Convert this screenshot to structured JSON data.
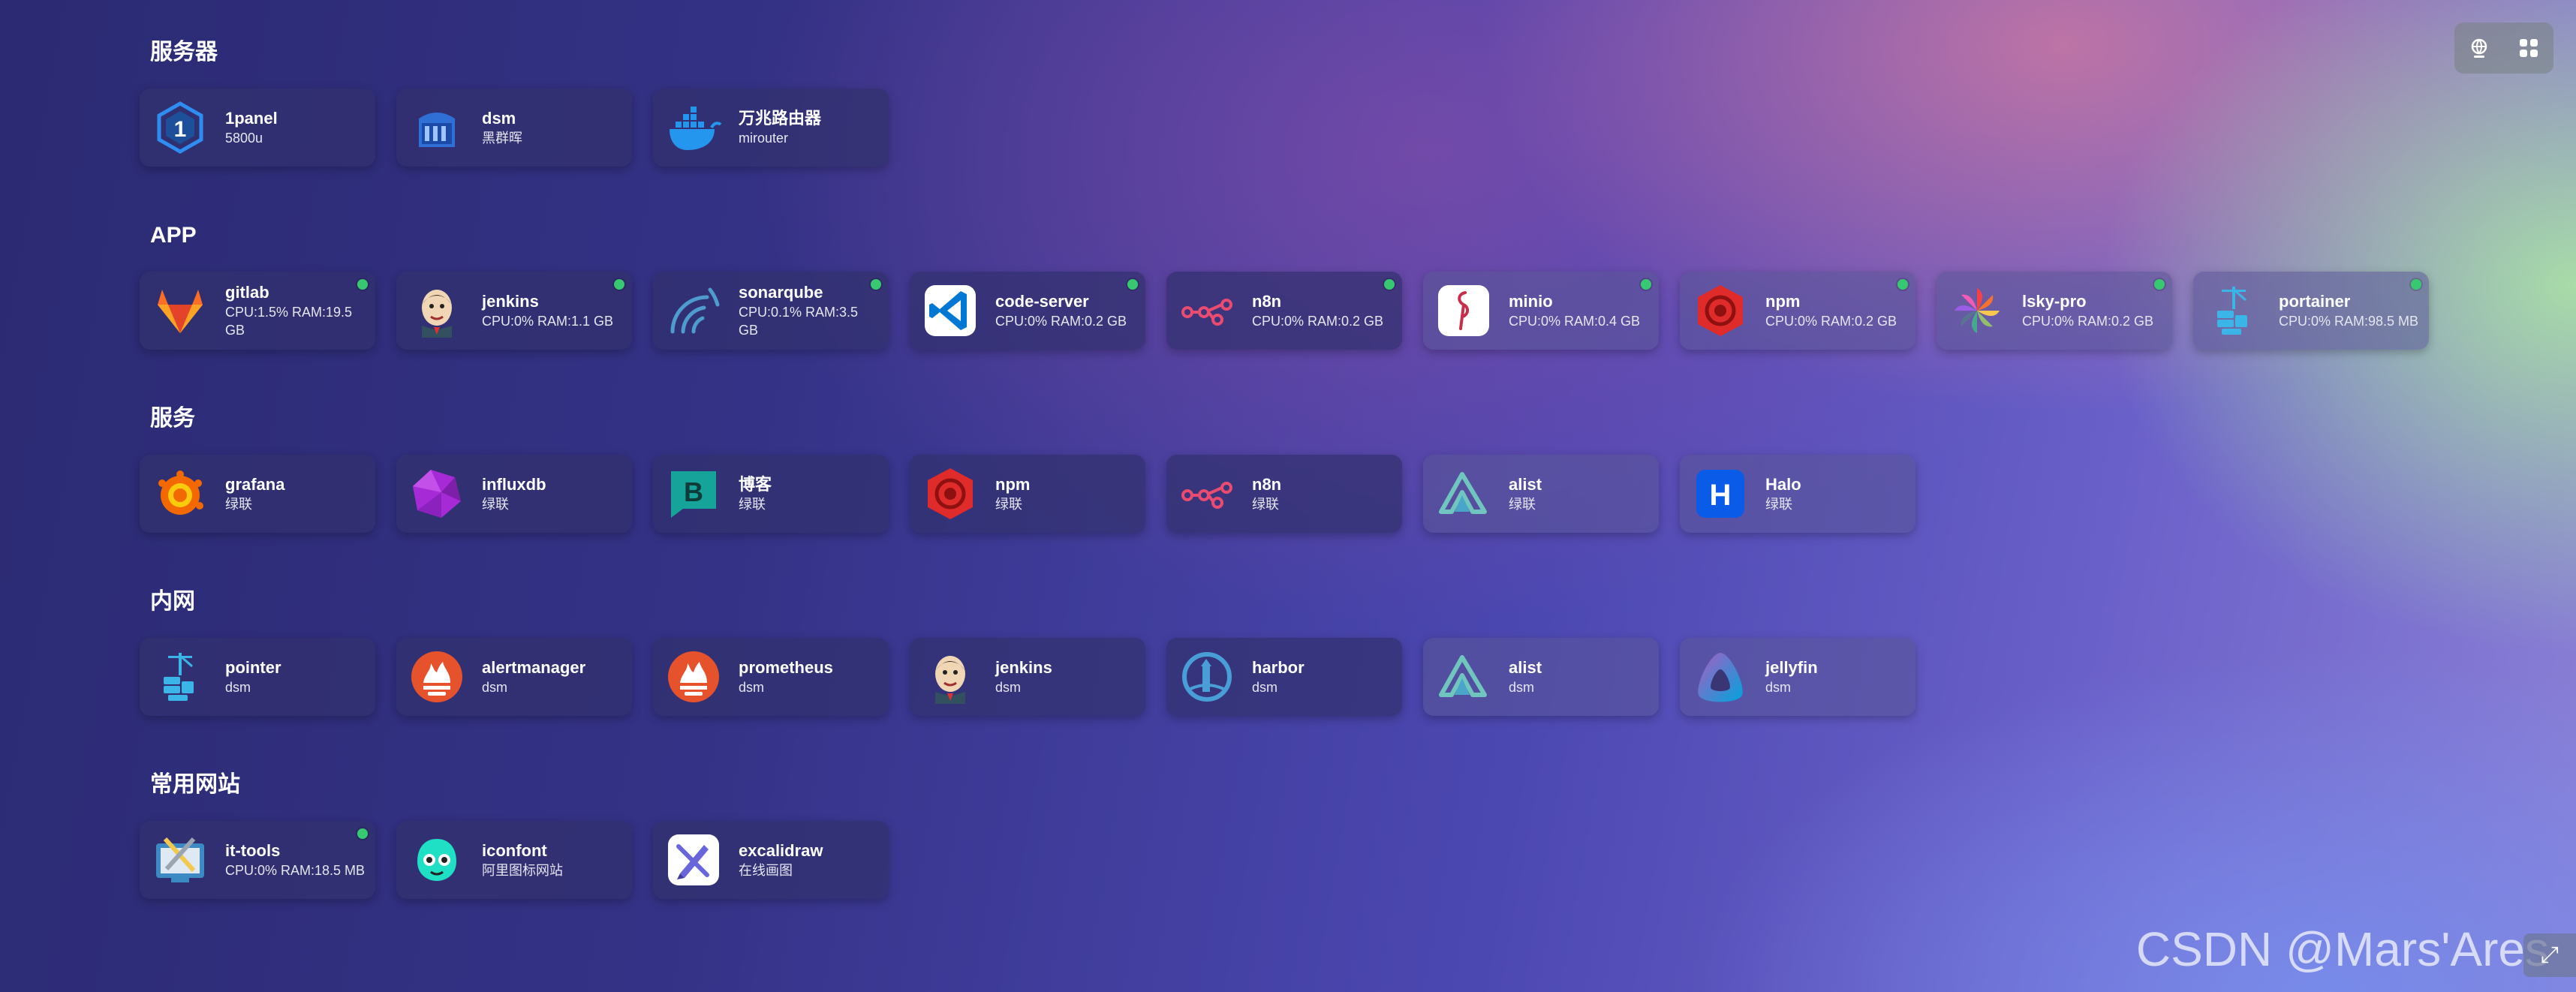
{
  "groups": [
    {
      "title": "服务器",
      "items": [
        {
          "name": "1panel",
          "sub": "5800u",
          "icon": "onepanel-icon",
          "status": false
        },
        {
          "name": "dsm",
          "sub": "黑群晖",
          "icon": "nas-icon",
          "status": false
        },
        {
          "name": "万兆路由器",
          "sub": "mirouter",
          "icon": "docker-icon",
          "status": false
        }
      ]
    },
    {
      "title": "APP",
      "items": [
        {
          "name": "gitlab",
          "sub": "CPU:1.5% RAM:19.5 GB",
          "icon": "gitlab-icon",
          "status": true
        },
        {
          "name": "jenkins",
          "sub": "CPU:0% RAM:1.1 GB",
          "icon": "jenkins-icon",
          "status": true
        },
        {
          "name": "sonarqube",
          "sub": "CPU:0.1% RAM:3.5 GB",
          "icon": "sonarqube-icon",
          "status": true
        },
        {
          "name": "code-server",
          "sub": "CPU:0% RAM:0.2 GB",
          "icon": "vscode-icon",
          "status": true
        },
        {
          "name": "n8n",
          "sub": "CPU:0% RAM:0.2 GB",
          "icon": "n8n-icon",
          "status": true
        },
        {
          "name": "minio",
          "sub": "CPU:0% RAM:0.4 GB",
          "icon": "minio-icon",
          "status": true
        },
        {
          "name": "npm",
          "sub": "CPU:0% RAM:0.2 GB",
          "icon": "npm-hexagon-icon",
          "status": true
        },
        {
          "name": "lsky-pro",
          "sub": "CPU:0% RAM:0.2 GB",
          "icon": "pinwheel-icon",
          "status": true
        },
        {
          "name": "portainer",
          "sub": "CPU:0% RAM:98.5 MB",
          "icon": "portainer-icon",
          "status": true
        }
      ]
    },
    {
      "title": "服务",
      "items": [
        {
          "name": "grafana",
          "sub": "绿联",
          "icon": "grafana-icon",
          "status": false
        },
        {
          "name": "influxdb",
          "sub": "绿联",
          "icon": "influxdb-icon",
          "status": false
        },
        {
          "name": "博客",
          "sub": "绿联",
          "icon": "blog-b-icon",
          "status": false
        },
        {
          "name": "npm",
          "sub": "绿联",
          "icon": "npm-hexagon-icon",
          "status": false
        },
        {
          "name": "n8n",
          "sub": "绿联",
          "icon": "n8n-icon",
          "status": false
        },
        {
          "name": "alist",
          "sub": "绿联",
          "icon": "alist-icon",
          "status": false
        },
        {
          "name": "Halo",
          "sub": "绿联",
          "icon": "halo-icon",
          "status": false
        }
      ]
    },
    {
      "title": "内网",
      "items": [
        {
          "name": "pointer",
          "sub": "dsm",
          "icon": "portainer-icon",
          "status": false
        },
        {
          "name": "alertmanager",
          "sub": "dsm",
          "icon": "prometheus-icon",
          "status": false
        },
        {
          "name": "prometheus",
          "sub": "dsm",
          "icon": "prometheus-icon",
          "status": false
        },
        {
          "name": "jenkins",
          "sub": "dsm",
          "icon": "jenkins-icon",
          "status": false
        },
        {
          "name": "harbor",
          "sub": "dsm",
          "icon": "harbor-icon",
          "status": false
        },
        {
          "name": "alist",
          "sub": "dsm",
          "icon": "alist-icon",
          "status": false
        },
        {
          "name": "jellyfin",
          "sub": "dsm",
          "icon": "jellyfin-icon",
          "status": false
        }
      ]
    },
    {
      "title": "常用网站",
      "items": [
        {
          "name": "it-tools",
          "sub": "CPU:0% RAM:18.5 MB",
          "icon": "it-tools-icon",
          "status": true
        },
        {
          "name": "iconfont",
          "sub": "阿里图标网站",
          "icon": "iconfont-icon",
          "status": false
        },
        {
          "name": "excalidraw",
          "sub": "在线画图",
          "icon": "excalidraw-icon",
          "status": false
        }
      ]
    }
  ],
  "toolbar": {
    "left_icon": "globe-icon",
    "right_icon": "grid-icon"
  },
  "watermark": "CSDN @Mars'Ares",
  "status_color": "#37c871"
}
